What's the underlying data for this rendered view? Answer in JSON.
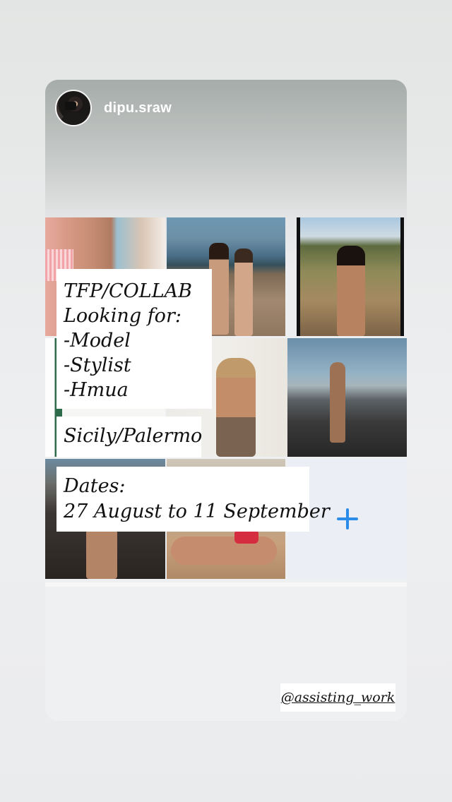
{
  "story": {
    "username": "dipu.sraw",
    "avatar_icon": "profile-photo-icon",
    "add_icon": "plus-icon",
    "accent_color": "#2a8ce8",
    "text_lines": [
      "TFP/COLLAB",
      "Looking for:",
      "-Model",
      "-Stylist",
      "-Hmua"
    ],
    "location": "Sicily/Palermo",
    "dates_label": "Dates:",
    "dates_value": "27 August to 11 September",
    "mention": "@assisting_work"
  }
}
